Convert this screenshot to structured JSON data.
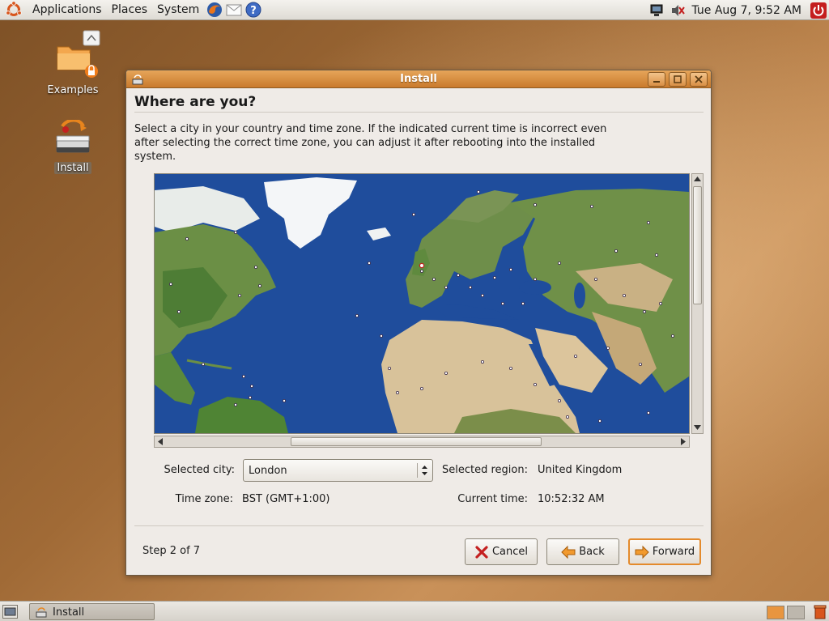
{
  "top_panel": {
    "menus": [
      "Applications",
      "Places",
      "System"
    ],
    "launchers": [
      "firefox-icon",
      "mail-icon",
      "help-icon"
    ],
    "clock": "Tue Aug  7,  9:52 AM"
  },
  "desktop": {
    "icons": [
      {
        "label": "Examples"
      },
      {
        "label": "Install"
      }
    ]
  },
  "window": {
    "title": "Install",
    "heading": "Where are you?",
    "intro": "Select a city in your country and time zone. If the indicated current time is incorrect even after selecting the correct time zone, you can adjust it after rebooting into the installed system.",
    "fields": {
      "selected_city_label": "Selected city:",
      "selected_city_value": "London",
      "selected_region_label": "Selected region:",
      "selected_region_value": "United Kingdom",
      "time_zone_label": "Time zone:",
      "time_zone_value": "BST (GMT+1:00)",
      "current_time_label": "Current time:",
      "current_time_value": "10:52:32 AM"
    },
    "step": "Step 2 of 7",
    "buttons": {
      "cancel": "Cancel",
      "back": "Back",
      "forward": "Forward"
    },
    "colors": {
      "titlebar": "#d98a3a",
      "ocean": "#1f4d9c",
      "land": "#5e8a3a",
      "desert": "#d8c29a",
      "default_button_border": "#e48a2c"
    }
  },
  "taskbar": {
    "task_label": "Install"
  }
}
